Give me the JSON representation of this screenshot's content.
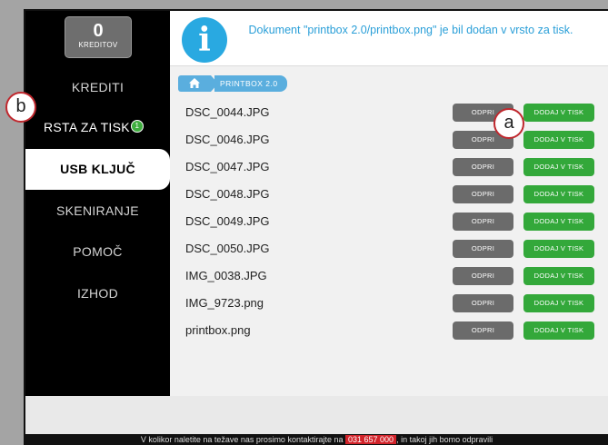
{
  "sidebar": {
    "credits_count": "0",
    "credits_label": "KREDITOV",
    "items": [
      {
        "label": "KREDITI"
      },
      {
        "label": "RSTA ZA TISK",
        "badge": "1"
      },
      {
        "label": "USB KLJUČ"
      },
      {
        "label": "SKENIRANJE"
      },
      {
        "label": "POMOČ"
      },
      {
        "label": "IZHOD"
      }
    ]
  },
  "header": {
    "icon": "info-icon",
    "icon_glyph": "i",
    "message": "Dokument \"printbox 2.0/printbox.png\" je bil dodan v vrsto za tisk."
  },
  "breadcrumb": {
    "home_icon": "home-icon",
    "folder": "PRINTBOX 2.0"
  },
  "files": [
    {
      "name": "DSC_0044.JPG",
      "open": "ODPRI",
      "add": "DODAJ V TISK"
    },
    {
      "name": "DSC_0046.JPG",
      "open": "ODPRI",
      "add": "DODAJ V TISK"
    },
    {
      "name": "DSC_0047.JPG",
      "open": "ODPRI",
      "add": "DODAJ V TISK"
    },
    {
      "name": "DSC_0048.JPG",
      "open": "ODPRI",
      "add": "DODAJ V TISK"
    },
    {
      "name": "DSC_0049.JPG",
      "open": "ODPRI",
      "add": "DODAJ V TISK"
    },
    {
      "name": "DSC_0050.JPG",
      "open": "ODPRI",
      "add": "DODAJ V TISK"
    },
    {
      "name": "IMG_0038.JPG",
      "open": "ODPRI",
      "add": "DODAJ V TISK"
    },
    {
      "name": "IMG_9723.png",
      "open": "ODPRI",
      "add": "DODAJ V TISK"
    },
    {
      "name": "printbox.png",
      "open": "ODPRI",
      "add": "DODAJ V TISK"
    }
  ],
  "footer": {
    "text_before": "V kolikor naletite na težave nas prosimo kontaktirajte na",
    "phone": "031 657 000",
    "text_after": ", in takoj jih bomo odpravili"
  },
  "callouts": {
    "a": "a",
    "b": "b"
  },
  "colors": {
    "accent_blue": "#29a9e1",
    "button_green": "#33a83a",
    "button_gray": "#6b6b6b",
    "badge_green": "#3fae3f",
    "phone_red": "#d2232a"
  }
}
